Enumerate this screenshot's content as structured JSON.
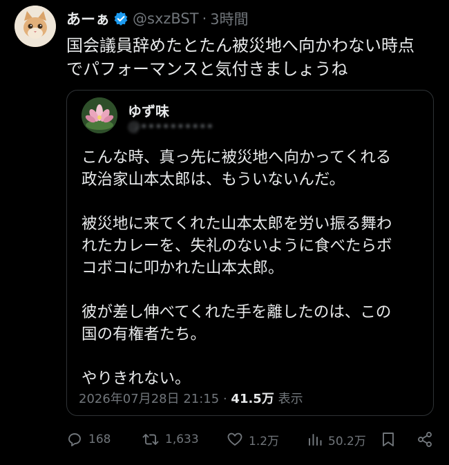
{
  "author": {
    "display_name": "あーぁ",
    "handle": "@sxzBST",
    "separator": "·",
    "time": "3時間",
    "verified": true
  },
  "tweet": {
    "lines": [
      "国会議員辞めたとたん被災地へ向かわない時点",
      "でパフォーマンスと気付きましょうね"
    ]
  },
  "quote": {
    "display_name": "ゆず味",
    "handle": "@••••••••••",
    "paragraphs": [
      [
        "こんな時、真っ先に被災地へ向かってくれる",
        "政治家山本太郎は、もういないんだ。"
      ],
      [
        "被災地に来てくれた山本太郎を労い振る舞わ",
        "れたカレーを、失礼のないように食べたらボ",
        "コボコに叩かれた山本太郎。"
      ],
      [
        "彼が差し伸べてくれた手を離したのは、この",
        "国の有権者たち。"
      ],
      [
        "やりきれない。"
      ]
    ],
    "timestamp": "2026年07月28日 21:15",
    "meta_separator": "·",
    "views_count": "41.5万",
    "views_label": "表示"
  },
  "actions": {
    "replies": "168",
    "retweets": "1,633",
    "likes": "1.2万",
    "views": "50.2万"
  },
  "icons": {
    "verified": "verified-badge-icon",
    "reply": "reply-icon",
    "retweet": "retweet-icon",
    "like": "heart-icon",
    "views": "views-chart-icon",
    "bookmark": "bookmark-icon",
    "share": "share-icon"
  },
  "colors": {
    "background": "#000000",
    "text": "#e7e9ea",
    "muted": "#71767b",
    "verified": "#1d9bf0",
    "border": "#2f3336"
  }
}
